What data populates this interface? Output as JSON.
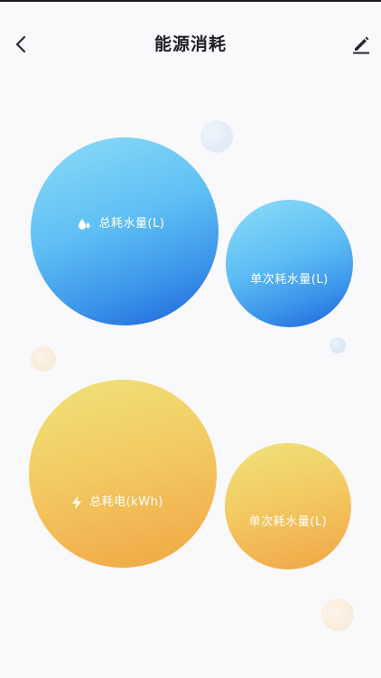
{
  "header": {
    "title": "能源消耗",
    "back_icon": "chevron-left-icon",
    "edit_icon": "pencil-icon"
  },
  "water": {
    "total_label": "总耗水量(L)",
    "total_icon": "water-drop-icon",
    "single_label": "单次耗水量(L)"
  },
  "electric": {
    "total_label": "总耗电(kWh)",
    "total_icon": "lightning-icon",
    "single_label": "单次耗水量(L)"
  },
  "colors": {
    "blue_light": "#8ddcf8",
    "blue_dark": "#1c61d8",
    "yellow_light": "#f0e27a",
    "yellow_dark": "#efa744",
    "title_text": "#1f1f24",
    "background": "#f9f9fb"
  }
}
